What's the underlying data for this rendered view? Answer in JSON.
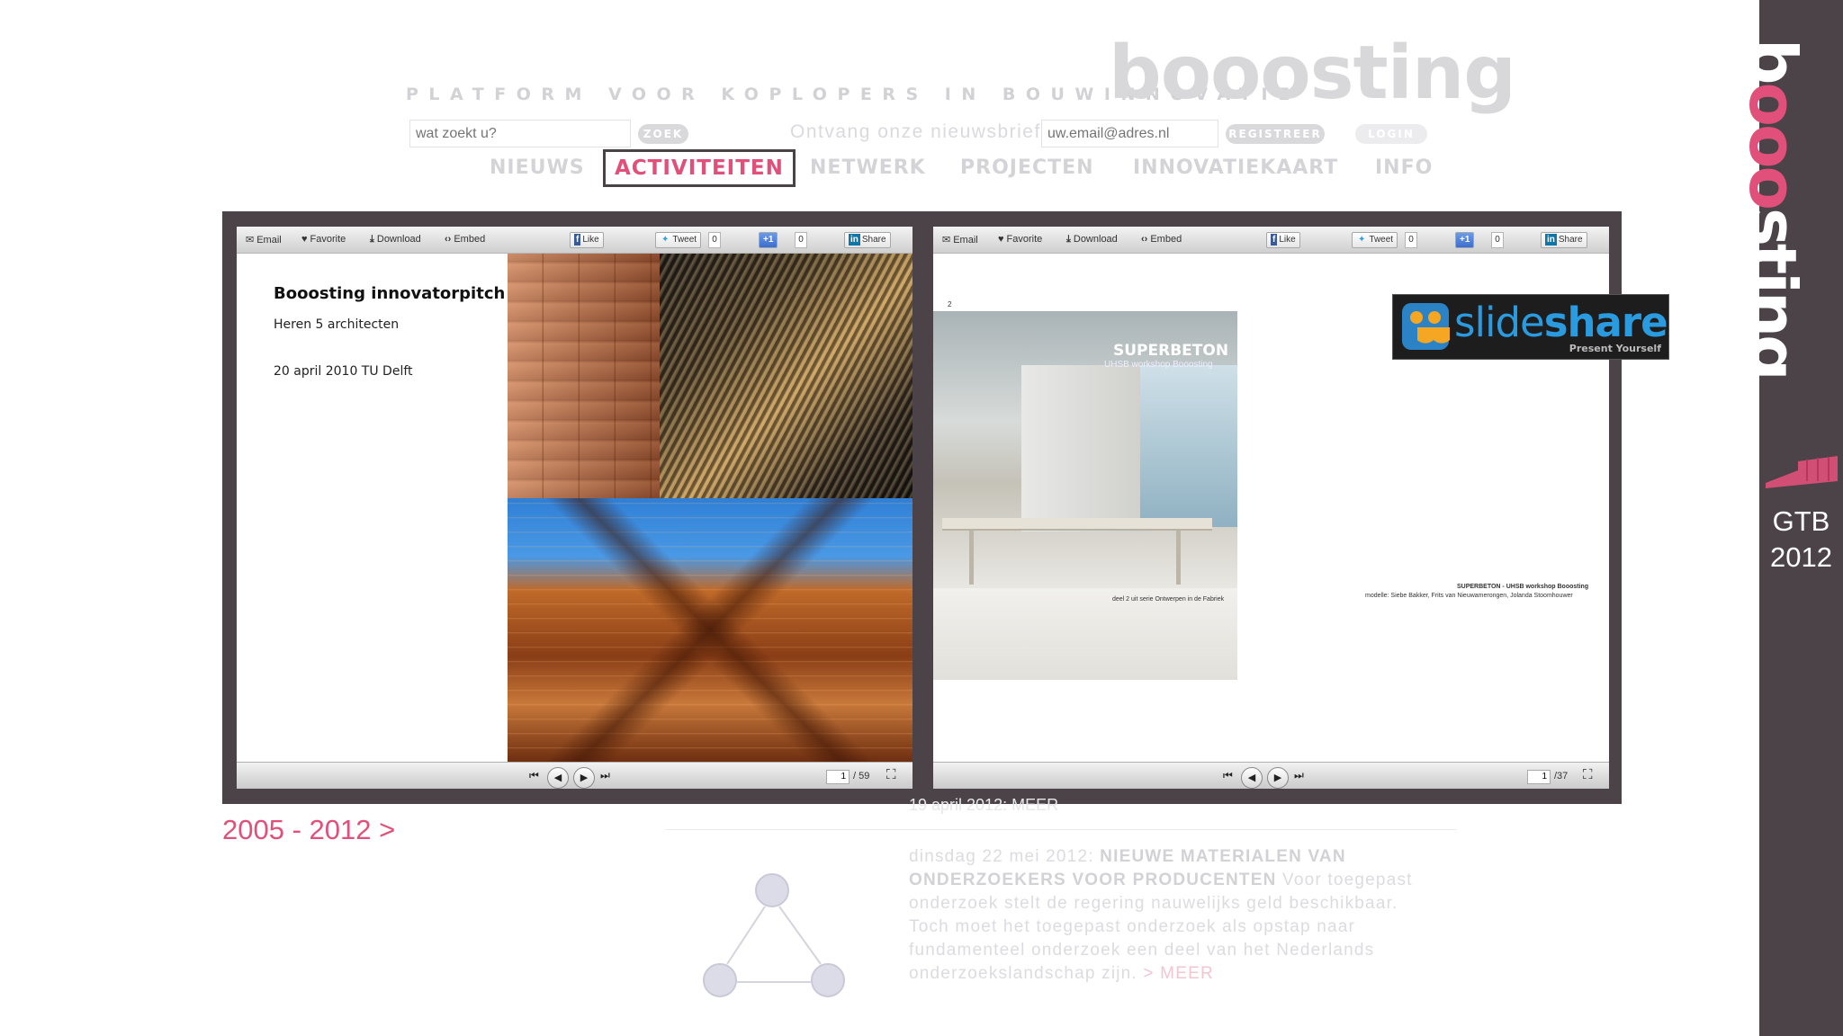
{
  "site": {
    "tagline": "PLATFORM VOOR KOPLOPERS IN BOUWINNOVATIE",
    "logo": "booosting",
    "search": {
      "placeholder": "wat zoekt u?",
      "button": "ZOEK"
    },
    "newsletter": {
      "label": "Ontvang onze nieuwsbrief:",
      "placeholder": "uw.email@adres.nl",
      "button": "REGISTREER"
    },
    "login_button": "LOGIN",
    "nav": [
      {
        "label": "NIEUWS",
        "active": false
      },
      {
        "label": "ACTIVITEITEN",
        "active": true
      },
      {
        "label": "NETWERK",
        "active": false
      },
      {
        "label": "PROJECTEN",
        "active": false
      },
      {
        "label": "INNOVATIEKAART",
        "active": false
      },
      {
        "label": "INFO",
        "active": false
      }
    ],
    "news": {
      "date_prefix": "dinsdag 22 mei 2012: ",
      "headline": "NIEUWE MATERIALEN VAN ONDERZOEKERS VOOR PRODUCENTEN",
      "body": " Voor toegepast onderzoek stelt de regering nauwelijks geld beschikbaar. Toch moet het toegepast onderzoek als opstap naar fundamenteel onderzoek een deel van het Nederlands onderzoekslandschap zijn.",
      "more": " > MEER",
      "prev_item_more": "19 april 2012:   MEER"
    }
  },
  "sidebar": {
    "brand_b": "b",
    "brand_o": "ooo",
    "brand_rest": "sting",
    "gtb_label": "GTB",
    "gtb_year": "2012"
  },
  "viewer_toolbar": {
    "email": "Email",
    "favorite": "Favorite",
    "download": "Download",
    "embed": "Embed",
    "like": "Like",
    "tweet": "Tweet",
    "plus_one": "+1",
    "share": "Share",
    "count": "0"
  },
  "viewer_left": {
    "slide_title": "Booosting innovatorpitch",
    "slide_subtitle": "Heren 5 architecten",
    "slide_date": "20 april 2010 TU Delft",
    "current_page": "1",
    "total_pages": "/ 59"
  },
  "viewer_right": {
    "slide_number": "2",
    "photo_title": "SUPERBETON",
    "photo_subtitle": "UHSB workshop Booosting",
    "caption_left": "deel 2 uit serie Ontwerpen in de Fabriek",
    "caption_right_title": "SUPERBETON - UHSB workshop Booosting",
    "caption_right_credits": "modelle: Siebe Bakker, Frits van Nieuwamerongen, Jolanda Stoomhouwer",
    "current_page": "1",
    "total_pages": "/37"
  },
  "slideshare": {
    "word_regular": "slide",
    "word_bold": "share",
    "tagline": "Present Yourself"
  },
  "year_link": "2005 - 2012 >",
  "colors": {
    "accent_pink": "#e0507a",
    "frame_dark": "#4b4347",
    "slideshare_blue": "#2b9be0"
  }
}
